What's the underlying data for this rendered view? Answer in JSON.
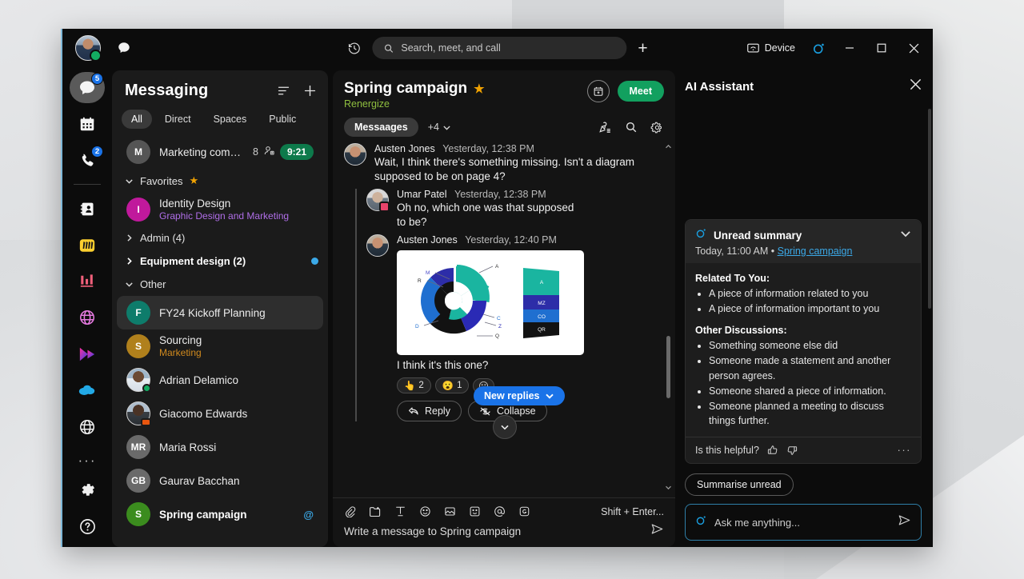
{
  "titlebar": {
    "chat_icon": "chat-bubble-icon",
    "history_icon": "history-icon",
    "search_placeholder": "Search, meet, and call",
    "new_label": "+",
    "device_label": "Device",
    "ai_icon": "ai-assistant-icon",
    "minimize": "minimize-icon",
    "maximize": "maximize-icon",
    "close": "close-icon"
  },
  "rail": {
    "items": [
      {
        "name": "messaging",
        "icon": "chat-bubble-icon",
        "badge": "5",
        "active": true
      },
      {
        "name": "calendar",
        "icon": "calendar-icon",
        "badge": "",
        "active": false
      },
      {
        "name": "calling",
        "icon": "phone-icon",
        "badge": "2",
        "active": false
      },
      {
        "name": "contacts",
        "icon": "contact-card-icon",
        "badge": "",
        "active": false
      },
      {
        "name": "app-miro",
        "icon": "miro-app-icon",
        "badge": "",
        "active": false
      },
      {
        "name": "app-analytics",
        "icon": "analytics-app-icon",
        "badge": "",
        "active": false
      },
      {
        "name": "app-globe-pink",
        "icon": "globe-pink-icon",
        "badge": "",
        "active": false
      },
      {
        "name": "app-play",
        "icon": "play-app-icon",
        "badge": "",
        "active": false
      },
      {
        "name": "app-salesforce",
        "icon": "cloud-app-icon",
        "badge": "",
        "active": false
      },
      {
        "name": "app-globe-white",
        "icon": "globe-white-icon",
        "badge": "",
        "active": false
      }
    ],
    "more": "···",
    "settings_icon": "gear-icon",
    "help_icon": "help-icon"
  },
  "list": {
    "title": "Messaging",
    "filter_icon": "filter-icon",
    "add_icon": "plus-icon",
    "tabs": [
      "All",
      "Direct",
      "Spaces",
      "Public"
    ],
    "active_tab": "All",
    "pinned": {
      "initial": "M",
      "name": "Marketing compai...",
      "count": "8",
      "people_icon": "people-icon",
      "time": "9:21"
    },
    "groups": [
      {
        "label": "Favorites",
        "expanded": true,
        "star": true
      },
      {
        "label": "Admin (4)",
        "expanded": false
      },
      {
        "label": "Equipment design (2)",
        "expanded": false,
        "bold": true,
        "dot": true
      },
      {
        "label": "Other",
        "expanded": true
      }
    ],
    "items": [
      {
        "name": "Identity Design",
        "sub": "Graphic Design and Marketing",
        "sub_color": "#b06ee8",
        "initial": "I",
        "color": "#c0199c",
        "after_group": 0
      },
      {
        "name": "FY24 Kickoff Planning",
        "sub": "",
        "initial": "F",
        "color": "#0e7c6b",
        "selected": true,
        "after_group": 3
      },
      {
        "name": "Sourcing",
        "sub": "Marketing",
        "sub_color": "#d08a1e",
        "initial": "S",
        "color": "#b0801c"
      },
      {
        "name": "Adrian Delamico",
        "sub": "",
        "photo": "p1",
        "presence": "available"
      },
      {
        "name": "Giacomo Edwards",
        "sub": "",
        "photo": "p2",
        "presence": "in-call"
      },
      {
        "name": "Maria Rossi",
        "sub": "",
        "initial": "MR",
        "color": "#6a6a6a"
      },
      {
        "name": "Gaurav Bacchan",
        "sub": "",
        "initial": "GB",
        "color": "#6a6a6a"
      },
      {
        "name": "Spring campaign",
        "sub": "",
        "initial": "S",
        "color": "#3b8c1e",
        "bold": true,
        "mention": "@"
      }
    ]
  },
  "chat": {
    "title": "Spring campaign",
    "starred": true,
    "subtitle": "Renergize",
    "calendar_icon": "calendar-add-icon",
    "meet_label": "Meet",
    "tabs": [
      "Messaages"
    ],
    "active_tab": "Messaages",
    "more_tabs": "+4",
    "pin_icon": "pin-list-icon",
    "search_icon": "search-icon",
    "settings_icon": "gear-icon",
    "messages": [
      {
        "author": "Austen Jones",
        "time": "Yesterday, 12:38 PM",
        "text": "Wait, I think there's something missing. Isn't a diagram supposed to be on page 4?",
        "nested": false
      },
      {
        "author": "Umar Patel",
        "time": "Yesterday, 12:38 PM",
        "text": "Oh no, which one was that supposed to be?",
        "nested": true
      },
      {
        "author": "Austen Jones",
        "time": "Yesterday, 12:40 PM",
        "text": "I think it's this one?",
        "nested": true,
        "attachment": "donut-and-bar-diagram"
      }
    ],
    "reactions": [
      {
        "emoji": "👆",
        "count": "2"
      },
      {
        "emoji": "😮",
        "count": "1"
      }
    ],
    "add_reaction_icon": "add-reaction-icon",
    "new_replies_label": "New replies",
    "reply_label": "Reply",
    "collapse_label": "Collapse",
    "scroll_down_icon": "chevron-down-icon"
  },
  "composer": {
    "icons": [
      "attach-icon",
      "folder-icon",
      "format-text-icon",
      "emoji-icon",
      "image-icon",
      "sticker-icon",
      "mention-icon",
      "giphy-icon"
    ],
    "hint": "Shift + Enter...",
    "placeholder": "Write a message to Spring campaign",
    "send_icon": "send-icon"
  },
  "ai": {
    "title": "AI Assistant",
    "close_icon": "close-icon",
    "card": {
      "icon": "ai-assistant-icon",
      "title": "Unread summary",
      "timestamp": "Today, 11:00 AM",
      "separator": "•",
      "link": "Spring campaign",
      "chevron_icon": "chevron-down-icon",
      "sections": [
        {
          "heading": "Related To You:",
          "bullets": [
            "A piece of information related to you",
            "A piece of information important to you"
          ]
        },
        {
          "heading": "Other Discussions:",
          "bullets": [
            "Something someone else did",
            "Someone made a statement and another person agrees.",
            "Someone shared a piece of information.",
            "Someone planned a meeting to discuss things further."
          ]
        }
      ],
      "feedback_question": "Is this helpful?",
      "thumbs_up_icon": "thumbs-up-icon",
      "thumbs_down_icon": "thumbs-down-icon",
      "more_icon": "more-icon"
    },
    "suggestion": "Summarise unread",
    "input_placeholder": "Ask me anything...",
    "input_icon": "ai-assistant-icon",
    "send_icon": "send-icon"
  },
  "diagram": {
    "type": "donut-and-stacked-bar",
    "donut_labels": [
      "A",
      "M",
      "R",
      "D",
      "C",
      "Z",
      "Q"
    ],
    "bar_labels": [
      "A",
      "MZ",
      "CO",
      "QR"
    ],
    "colors": [
      "#18b09b",
      "#2a2ab0",
      "#1574d6",
      "#111111",
      "#2323a8"
    ]
  },
  "colors": {
    "accent_blue": "#1a73e8",
    "meet_green": "#12a05f",
    "star_gold": "#f0a202",
    "link_blue": "#3ba9e8",
    "subtitle_green": "#8fbf3f",
    "window_bg": "#0c0c0c"
  }
}
